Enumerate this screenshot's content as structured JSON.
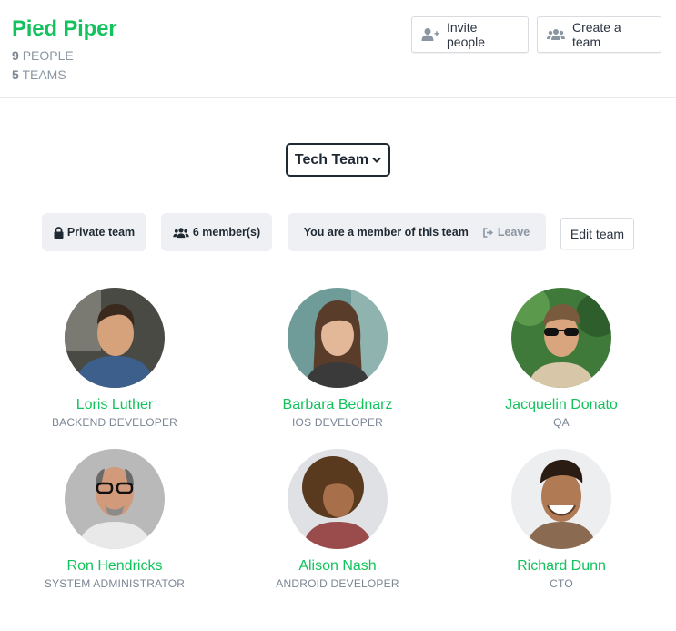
{
  "org": {
    "name": "Pied Piper",
    "people_count": "9",
    "people_label": "PEOPLE",
    "teams_count": "5",
    "teams_label": "TEAMS"
  },
  "actions": {
    "invite_label": "Invite people",
    "invite_icon": "user-plus-icon",
    "create_label": "Create a team",
    "create_icon": "users-icon"
  },
  "team_selector": {
    "selected": "Tech Team",
    "icon": "chevron-down-icon"
  },
  "team_info": {
    "privacy": "Private team",
    "privacy_icon": "lock-icon",
    "members": "6 member(s)",
    "members_icon": "users-icon",
    "membership_status": "You are a member of this team",
    "leave_label": "Leave",
    "leave_icon": "sign-out-icon",
    "edit_label": "Edit team"
  },
  "members": [
    {
      "name": "Loris Luther",
      "role": "BACKEND DEVELOPER"
    },
    {
      "name": "Barbara Bednarz",
      "role": "IOS DEVELOPER"
    },
    {
      "name": "Jacquelin Donato",
      "role": "QA"
    },
    {
      "name": "Ron Hendricks",
      "role": "SYSTEM ADMINISTRATOR"
    },
    {
      "name": "Alison Nash",
      "role": "ANDROID DEVELOPER"
    },
    {
      "name": "Richard Dunn",
      "role": "CTO"
    }
  ],
  "colors": {
    "accent": "#12c25c",
    "muted": "#7a8593",
    "pill_bg": "#eef0f3"
  }
}
